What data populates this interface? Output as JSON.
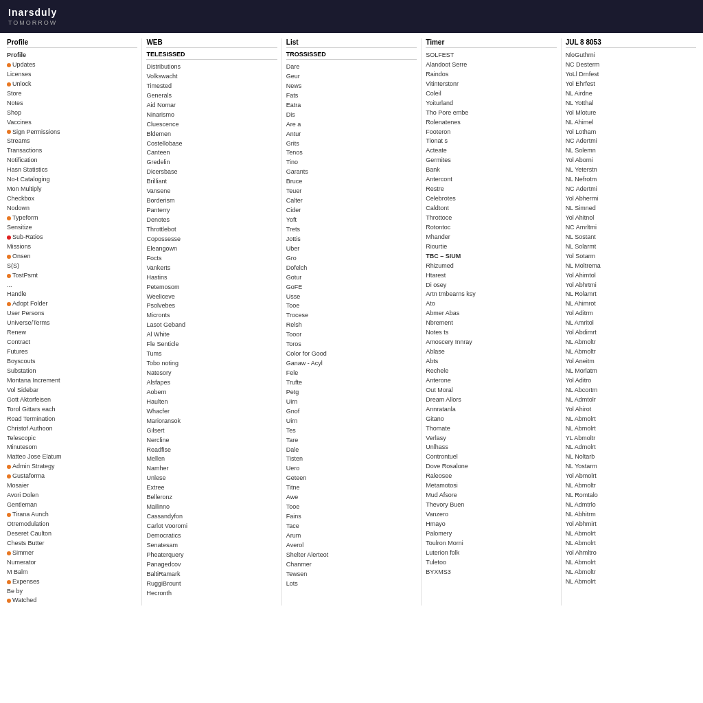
{
  "header": {
    "title": "Inarsduly",
    "subtitle": "TOMORROW"
  },
  "columns": [
    {
      "header": "Profile",
      "items": [
        {
          "text": "Profile",
          "bold": true
        },
        {
          "text": "Updates",
          "dot": "orange"
        },
        {
          "text": "Licenses"
        },
        {
          "text": "Unlock",
          "dot": "orange"
        },
        {
          "text": "Store"
        },
        {
          "text": "Notes"
        },
        {
          "text": "Shop"
        },
        {
          "text": "Vaccines"
        },
        {
          "text": "Sign Permissions",
          "dot": "orange"
        },
        {
          "text": "Streams"
        },
        {
          "text": "Transactions"
        },
        {
          "text": "Notification"
        },
        {
          "text": "Hasn Statistics"
        },
        {
          "text": "No-t Cataloging"
        },
        {
          "text": "Mon Multiply"
        },
        {
          "text": "Checkbox"
        },
        {
          "text": "Nodown"
        },
        {
          "text": "Typeform",
          "dot": "orange"
        },
        {
          "text": "Sensitize",
          "dot": ""
        },
        {
          "text": "Sub-Ratios",
          "dot": "red"
        },
        {
          "text": "Missions"
        },
        {
          "text": "Onsen",
          "dot": "orange"
        },
        {
          "text": "S(S)"
        },
        {
          "text": "TostPsmt",
          "dot": "orange"
        },
        {
          "text": "..."
        },
        {
          "text": "Handle"
        },
        {
          "text": "Adopt Folder",
          "dot": "orange"
        },
        {
          "text": "User Persons"
        },
        {
          "text": "Universe/Terms"
        },
        {
          "text": "Renew"
        },
        {
          "text": "Contract"
        },
        {
          "text": "Futures"
        },
        {
          "text": "Boyscouts"
        },
        {
          "text": "Substation"
        },
        {
          "text": "Montana Increment"
        },
        {
          "text": "Vol Sidebar"
        },
        {
          "text": "Gott Aktorfeisen"
        },
        {
          "text": "Torol Gittars each"
        },
        {
          "text": "Road Termination"
        },
        {
          "text": "Christof Authoon"
        },
        {
          "text": "Telescopic"
        },
        {
          "text": "Minutesom"
        },
        {
          "text": "Matteo Jose Elatum"
        },
        {
          "text": "Admin Strategy",
          "dot": "orange"
        },
        {
          "text": "Gustaforma",
          "dot": "orange"
        },
        {
          "text": "Mosaier"
        },
        {
          "text": "Avori Dolen"
        },
        {
          "text": "Gentleman",
          "dot": ""
        },
        {
          "text": "Tirana Aunch",
          "dot": "orange"
        },
        {
          "text": "Otremodulation"
        },
        {
          "text": "Deseret Caulton"
        },
        {
          "text": "Chests Butter"
        },
        {
          "text": "Simmer",
          "dot": "orange"
        },
        {
          "text": "Numerator"
        },
        {
          "text": "M Balm"
        },
        {
          "text": "Expenses",
          "dot": "orange"
        },
        {
          "text": "Be by"
        },
        {
          "text": "Watched",
          "dot": "orange"
        }
      ]
    },
    {
      "header": "WEB",
      "subheader": "TELESISSED",
      "items": [
        {
          "text": "Distributions"
        },
        {
          "text": "Volkswacht"
        },
        {
          "text": "Timested"
        },
        {
          "text": "Generals"
        },
        {
          "text": "Aid Nomar"
        },
        {
          "text": "Ninarismo"
        },
        {
          "text": "Cluescence"
        },
        {
          "text": "Bldemen"
        },
        {
          "text": "Costellobase"
        },
        {
          "text": "Canteen"
        },
        {
          "text": "Gredelin"
        },
        {
          "text": "Dicersbase"
        },
        {
          "text": "Brilliant"
        },
        {
          "text": "Vansene"
        },
        {
          "text": "Borderism"
        },
        {
          "text": "Panterry"
        },
        {
          "text": "Denotes"
        },
        {
          "text": "Throttlebot"
        },
        {
          "text": "Copossesse"
        },
        {
          "text": "Eleangown"
        },
        {
          "text": "Focts"
        },
        {
          "text": "Vankerts"
        },
        {
          "text": "Hastins"
        },
        {
          "text": "Petemosom"
        },
        {
          "text": "Weeliceve"
        },
        {
          "text": "Psolvebes"
        },
        {
          "text": "Micronts"
        },
        {
          "text": "Lasot Geband"
        },
        {
          "text": "Al White"
        },
        {
          "text": "Fle Senticle"
        },
        {
          "text": "Tums"
        },
        {
          "text": "Tobo noting"
        },
        {
          "text": "Natesory"
        },
        {
          "text": "Alsfapes"
        },
        {
          "text": "Aobern"
        },
        {
          "text": "Haulten"
        },
        {
          "text": "Whacfer"
        },
        {
          "text": "Marioransok"
        },
        {
          "text": "Gilsert"
        },
        {
          "text": "Nercline"
        },
        {
          "text": "Readfise"
        },
        {
          "text": "Mellen"
        },
        {
          "text": "Namher"
        },
        {
          "text": "Unlese"
        },
        {
          "text": "Extree"
        },
        {
          "text": "Belleronz"
        },
        {
          "text": "Mailinno"
        },
        {
          "text": "Cassandyfon"
        },
        {
          "text": "Carlot Vooromi"
        },
        {
          "text": "Democratics"
        },
        {
          "text": "Senatesam"
        },
        {
          "text": "Pheaterquery"
        },
        {
          "text": "Panagedcov"
        },
        {
          "text": "BaltiRamark"
        },
        {
          "text": "RuggiBrount"
        },
        {
          "text": "Hecronth"
        }
      ]
    },
    {
      "header": "List",
      "subheader": "TROSSISSED",
      "items": [
        {
          "text": "Dare"
        },
        {
          "text": "Geur"
        },
        {
          "text": "News"
        },
        {
          "text": "Fats"
        },
        {
          "text": "Eatra"
        },
        {
          "text": "Dis"
        },
        {
          "text": "Are a"
        },
        {
          "text": "Antur"
        },
        {
          "text": "Grits"
        },
        {
          "text": "Tenos"
        },
        {
          "text": "Tino"
        },
        {
          "text": "Garants"
        },
        {
          "text": "Bruce"
        },
        {
          "text": "Teuer"
        },
        {
          "text": "Calter"
        },
        {
          "text": "Cider"
        },
        {
          "text": "Yoft"
        },
        {
          "text": "Trets"
        },
        {
          "text": "Jottis"
        },
        {
          "text": "Uber"
        },
        {
          "text": "Gro"
        },
        {
          "text": "Dofelch"
        },
        {
          "text": "Gotur"
        },
        {
          "text": "GoFE"
        },
        {
          "text": "Usse"
        },
        {
          "text": "Tooe"
        },
        {
          "text": "Trocese"
        },
        {
          "text": "Relsh"
        },
        {
          "text": "Tooor"
        },
        {
          "text": "Toros"
        },
        {
          "text": "Color for Good"
        },
        {
          "text": "Ganaw - Acyl"
        },
        {
          "text": "Fele"
        },
        {
          "text": "Trufte"
        },
        {
          "text": "Petg"
        },
        {
          "text": "Uirn"
        },
        {
          "text": "Gnof"
        },
        {
          "text": "Uirn"
        },
        {
          "text": "Tes"
        },
        {
          "text": "Tare"
        },
        {
          "text": "Dale"
        },
        {
          "text": "Tisten"
        },
        {
          "text": "Uero"
        },
        {
          "text": "Geteen"
        },
        {
          "text": "Titne"
        },
        {
          "text": "Awe"
        },
        {
          "text": "Tooe"
        },
        {
          "text": "Fains"
        },
        {
          "text": "Tace"
        },
        {
          "text": "Arum"
        },
        {
          "text": "Averol"
        },
        {
          "text": "Shelter Alerteot"
        },
        {
          "text": "Chanmer"
        },
        {
          "text": "Tewsen"
        },
        {
          "text": "Lots"
        }
      ]
    },
    {
      "header": "Timer",
      "items": [
        {
          "text": "SOLFEST"
        },
        {
          "text": "Alandoot Serre"
        },
        {
          "text": "Raindos"
        },
        {
          "text": "Vitinterstonr"
        },
        {
          "text": "Coleil"
        },
        {
          "text": "Yoiturland"
        },
        {
          "text": "Tho Pore embe"
        },
        {
          "text": "Rolenatenes"
        },
        {
          "text": "Footeron"
        },
        {
          "text": "Tionat s"
        },
        {
          "text": "Acteate"
        },
        {
          "text": "Germites"
        },
        {
          "text": "Bank"
        },
        {
          "text": "Antercont"
        },
        {
          "text": "Restre"
        },
        {
          "text": "Celebrotes"
        },
        {
          "text": "Caldtont"
        },
        {
          "text": "Throttoce"
        },
        {
          "text": "Rotontoc"
        },
        {
          "text": "Mhander"
        },
        {
          "text": "Riourtie"
        },
        {
          "text": ""
        },
        {
          "text": "TBC – SIUM",
          "bold": true
        },
        {
          "text": "Rhizumed"
        },
        {
          "text": "Htarest"
        },
        {
          "text": "Di osey"
        },
        {
          "text": "Artn tmbearns ksy"
        },
        {
          "text": "Ato"
        },
        {
          "text": "Abmer Abas"
        },
        {
          "text": "Nbrement"
        },
        {
          "text": "Notes ts"
        },
        {
          "text": "Amoscery Innray"
        },
        {
          "text": "Ablase"
        },
        {
          "text": "Abts"
        },
        {
          "text": "Rechele"
        },
        {
          "text": "Anterone"
        },
        {
          "text": "Out Moral"
        },
        {
          "text": "Dream Allors"
        },
        {
          "text": "Annratanla"
        },
        {
          "text": "Gitano"
        },
        {
          "text": "Thomate"
        },
        {
          "text": "Verlasy"
        },
        {
          "text": "Unlhass"
        },
        {
          "text": "Controntuel"
        },
        {
          "text": "Dove Rosalone"
        },
        {
          "text": "Raleosee"
        },
        {
          "text": "Metamotosi"
        },
        {
          "text": "Mud Afsore"
        },
        {
          "text": "Thevory Buen"
        },
        {
          "text": "Vanzero"
        },
        {
          "text": "Hmayo"
        },
        {
          "text": "Palomery"
        },
        {
          "text": "Toulron Morni"
        },
        {
          "text": "Luterion folk"
        },
        {
          "text": "Tuletoo"
        },
        {
          "text": "BYXMS3"
        }
      ]
    },
    {
      "header": "JUL 8 8053",
      "items": [
        {
          "text": "NloGuthrni"
        },
        {
          "text": "NC Desterm"
        },
        {
          "text": "YoLl Drnfest"
        },
        {
          "text": "Yol Ehrfest"
        },
        {
          "text": "NL Airdne"
        },
        {
          "text": "NL Yotthal"
        },
        {
          "text": "Yol Mloture"
        },
        {
          "text": "NL Ahimel"
        },
        {
          "text": "Yol Lotham"
        },
        {
          "text": "NC Adertmi"
        },
        {
          "text": "NL Solemn"
        },
        {
          "text": "Yol Aborni"
        },
        {
          "text": "NL Yeterstn"
        },
        {
          "text": "NL Nefrotm"
        },
        {
          "text": "NC Adertmi"
        },
        {
          "text": "Yol Abhermi"
        },
        {
          "text": "NL Simned"
        },
        {
          "text": "Yol Ahitnol"
        },
        {
          "text": "NC Amrltmi"
        },
        {
          "text": "NL Sostant"
        },
        {
          "text": "NL Solarmt"
        },
        {
          "text": "Yol Sotarm"
        },
        {
          "text": "NL Moltrema"
        },
        {
          "text": "Yol Ahimtol"
        },
        {
          "text": "Yol Abhrtmi"
        },
        {
          "text": "NL Rolamrt"
        },
        {
          "text": "NL Ahimrot"
        },
        {
          "text": "Yol Aditrm"
        },
        {
          "text": "NL Amritol"
        },
        {
          "text": "Yol Abdimrt"
        },
        {
          "text": "NL Abmoltr"
        },
        {
          "text": "NL Abmoltr"
        },
        {
          "text": "Yol Aneitm"
        },
        {
          "text": "NL Morlatm"
        },
        {
          "text": "Yol Aditro"
        },
        {
          "text": "NL Abcortm"
        },
        {
          "text": "NL Admtolr"
        },
        {
          "text": "Yol Ahirot"
        },
        {
          "text": "NL Abmolrt"
        },
        {
          "text": "NL Abmolrt"
        },
        {
          "text": "YL Abmoltr"
        },
        {
          "text": "NL Admolrt"
        },
        {
          "text": "NL Noltarb"
        },
        {
          "text": "NL Yostarm"
        },
        {
          "text": "Yol Abmolrt"
        },
        {
          "text": "NL Abmoltr"
        },
        {
          "text": "NL Romtalo"
        },
        {
          "text": "NL Admtrlo"
        },
        {
          "text": "NL Abhitrm"
        },
        {
          "text": "Yol Abhmirt"
        },
        {
          "text": "NL Abmolrt"
        },
        {
          "text": "NL Abmolrt"
        },
        {
          "text": "Yol Ahmltro"
        },
        {
          "text": "NL Abmolrt"
        },
        {
          "text": "NL Abmoltr"
        },
        {
          "text": "NL Abmolrt"
        }
      ]
    }
  ]
}
